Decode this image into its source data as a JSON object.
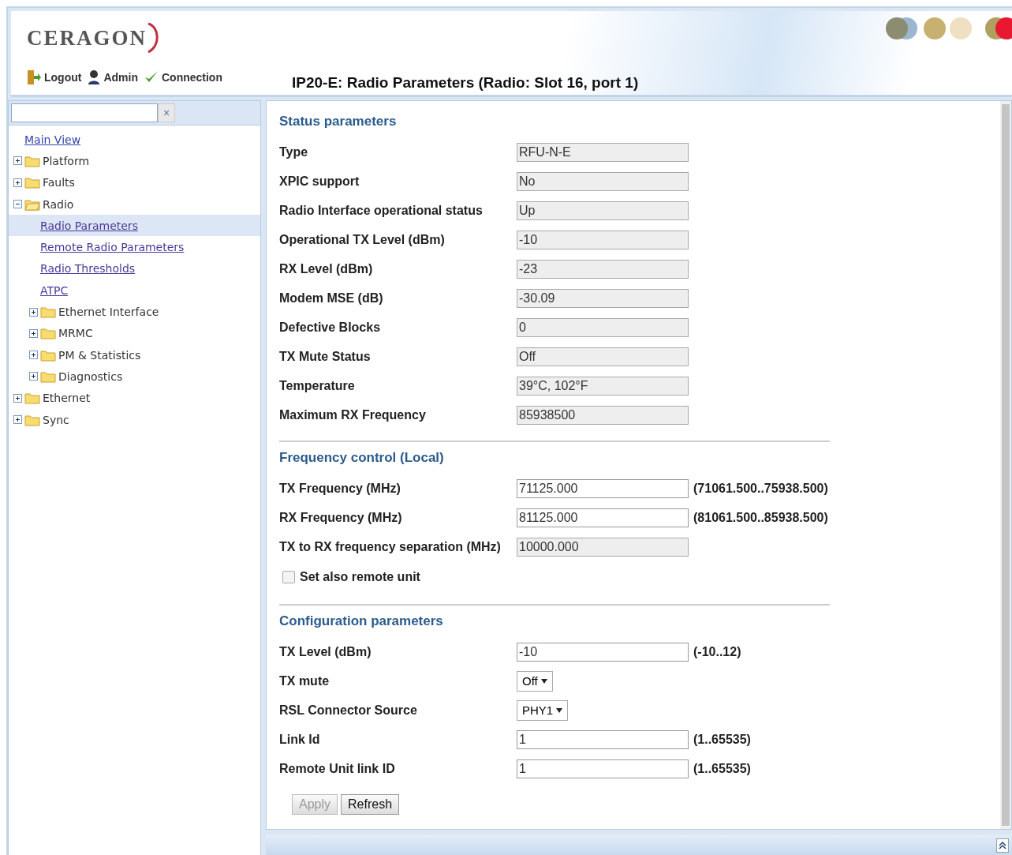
{
  "header": {
    "logo": "CERAGON",
    "links": [
      {
        "kind": "logout",
        "label": "Logout"
      },
      {
        "kind": "user",
        "label": "Admin"
      },
      {
        "kind": "connection",
        "label": "Connection"
      }
    ]
  },
  "page_title": "IP20-E: Radio Parameters (Radio: Slot 16, port 1)",
  "sidebar": {
    "search": {
      "clear": "×"
    },
    "tree": [
      {
        "kind": "link",
        "label": "Main View",
        "selected": false
      },
      {
        "kind": "folder",
        "label": "Platform",
        "expanded": false
      },
      {
        "kind": "folder",
        "label": "Faults",
        "expanded": false
      },
      {
        "kind": "folder",
        "label": "Radio",
        "expanded": true,
        "children": [
          {
            "kind": "link",
            "label": "Radio Parameters",
            "selected": true
          },
          {
            "kind": "link",
            "label": "Remote Radio Parameters",
            "selected": false
          },
          {
            "kind": "link",
            "label": "Radio Thresholds",
            "selected": false
          },
          {
            "kind": "link",
            "label": "ATPC",
            "selected": false
          },
          {
            "kind": "folder",
            "label": "Ethernet Interface",
            "expanded": false
          },
          {
            "kind": "folder",
            "label": "MRMC",
            "expanded": false
          },
          {
            "kind": "folder",
            "label": "PM & Statistics",
            "expanded": false
          },
          {
            "kind": "folder",
            "label": "Diagnostics",
            "expanded": false
          }
        ]
      },
      {
        "kind": "folder",
        "label": "Ethernet",
        "expanded": false
      },
      {
        "kind": "folder",
        "label": "Sync",
        "expanded": false
      }
    ]
  },
  "sections": [
    {
      "title": "Status parameters",
      "rows": [
        {
          "kind": "readonly",
          "label": "Type",
          "value": "RFU-N-E"
        },
        {
          "kind": "readonly",
          "label": "XPIC support",
          "value": "No"
        },
        {
          "kind": "readonly",
          "label": "Radio Interface operational status",
          "value": "Up"
        },
        {
          "kind": "readonly",
          "label": "Operational TX Level (dBm)",
          "value": "-10"
        },
        {
          "kind": "readonly",
          "label": "RX Level (dBm)",
          "value": "-23"
        },
        {
          "kind": "readonly",
          "label": "Modem MSE (dB)",
          "value": "-30.09"
        },
        {
          "kind": "readonly",
          "label": "Defective Blocks",
          "value": "0"
        },
        {
          "kind": "readonly",
          "label": "TX Mute Status",
          "value": "Off"
        },
        {
          "kind": "readonly",
          "label": "Temperature",
          "value": "39°C, 102°F"
        },
        {
          "kind": "readonly",
          "label": "Maximum RX Frequency",
          "value": "85938500"
        }
      ]
    },
    {
      "title": "Frequency control (Local)",
      "rows": [
        {
          "kind": "input",
          "label": "TX Frequency (MHz)",
          "value": "71125.000",
          "range": "(71061.500..75938.500)"
        },
        {
          "kind": "input",
          "label": "RX Frequency (MHz)",
          "value": "81125.000",
          "range": "(81061.500..85938.500)"
        },
        {
          "kind": "readonly",
          "label": "TX to RX frequency separation (MHz)",
          "value": "10000.000"
        },
        {
          "kind": "checkbox",
          "label": "Set also remote unit",
          "checked": false
        }
      ]
    },
    {
      "title": "Configuration parameters",
      "rows": [
        {
          "kind": "input",
          "label": "TX Level (dBm)",
          "value": "-10",
          "range": "(-10..12)"
        },
        {
          "kind": "select",
          "label": "TX mute",
          "value": "Off"
        },
        {
          "kind": "select",
          "label": "RSL Connector Source",
          "value": "PHY1"
        },
        {
          "kind": "input",
          "label": "Link Id",
          "value": "1",
          "range": "(1..65535)"
        },
        {
          "kind": "input",
          "label": "Remote Unit link ID",
          "value": "1",
          "range": "(1..65535)"
        }
      ]
    }
  ],
  "buttons": [
    {
      "label": "Apply",
      "disabled": true
    },
    {
      "label": "Refresh",
      "disabled": false
    }
  ]
}
